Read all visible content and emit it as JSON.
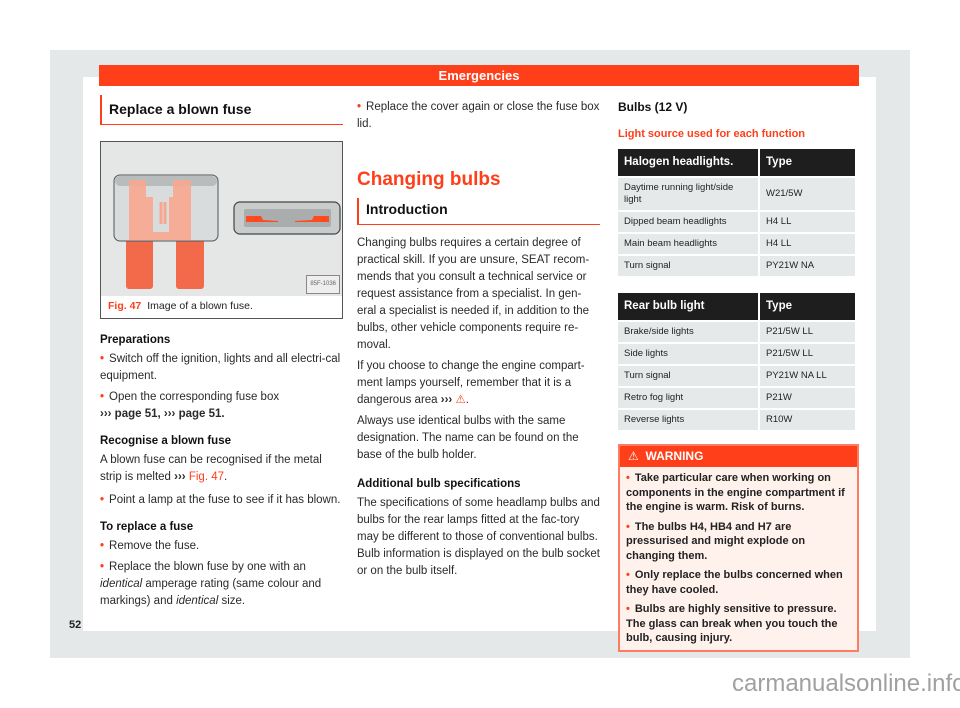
{
  "header": {
    "section": "Emergencies"
  },
  "left": {
    "title": "Replace a blown fuse",
    "figure": {
      "code": "85F-1036",
      "label": "Fig. 47",
      "caption": "Image of a blown fuse."
    },
    "preparations": {
      "heading": "Preparations",
      "bullets": [
        "Switch off the ignition, lights and all electri-cal equipment.",
        "Open the corresponding fuse box"
      ],
      "xref": "››› page 51, ››› page 51."
    },
    "recognise": {
      "heading": "Recognise a blown fuse",
      "text": "A blown fuse can be recognised if the metal strip is melted ",
      "xref_arrow": "›››",
      "xref_fig": "Fig. 47",
      "bullet": "Point a lamp at the fuse to see if it has blown."
    },
    "replace": {
      "heading": "To replace a fuse",
      "bullet1": "Remove the fuse.",
      "bullet2_pre": "Replace the blown fuse by one with an ",
      "bullet2_em1": "identical",
      "bullet2_mid": " amperage rating (same colour and markings) and ",
      "bullet2_em2": "identical",
      "bullet2_post": " size."
    }
  },
  "middle": {
    "bullet": "Replace the cover again or close the fuse box lid.",
    "title": "Changing bulbs",
    "subtitle": "Introduction",
    "p1": "Changing bulbs requires a certain degree of practical skill. If you are unsure, SEAT recom-mends that you consult a technical service or request assistance from a specialist. In gen-eral a specialist is needed if, in addition to the bulbs, other vehicle components require re-moval.",
    "p2": "If you choose to change the engine compart-ment lamps yourself, remember that it is a dangerous area ",
    "p2_arrow": "›››",
    "p3": "Always use identical bulbs with the same designation. The name can be found on the base of the bulb holder.",
    "additional_heading": "Additional bulb specifications",
    "p4": "The specifications of some headlamp bulbs and bulbs for the rear lamps fitted at the fac-tory may be different to those of conventional bulbs. Bulb information is displayed on the bulb socket or on the bulb itself."
  },
  "right": {
    "title": "Bulbs (12 V)",
    "table_title": "Light source used for each function",
    "table1": {
      "headers": [
        "Halogen headlights.",
        "Type"
      ],
      "rows": [
        [
          "Daytime running light/side light",
          "W21/5W"
        ],
        [
          "Dipped beam headlights",
          "H4 LL"
        ],
        [
          "Main beam headlights",
          "H4 LL"
        ],
        [
          "Turn signal",
          "PY21W NA"
        ]
      ]
    },
    "table2": {
      "headers": [
        "Rear bulb light",
        "Type"
      ],
      "rows": [
        [
          "Brake/side lights",
          "P21/5W LL"
        ],
        [
          "Side lights",
          "P21/5W LL"
        ],
        [
          "Turn signal",
          "PY21W NA LL"
        ],
        [
          "Retro fog light",
          "P21W"
        ],
        [
          "Reverse lights",
          "R10W"
        ]
      ]
    },
    "warning": {
      "label": "WARNING",
      "items": [
        "Take particular care when working on components in the engine compartment if the engine is warm. Risk of burns.",
        "The bulbs H4, HB4 and H7 are pressurised and might explode on changing them.",
        "Only replace the bulbs concerned when they have cooled.",
        "Bulbs are highly sensitive to pressure. The glass can break when you touch the bulb, causing injury."
      ]
    }
  },
  "footer": {
    "page_number": "52",
    "watermark": "carmanualsonline.info"
  },
  "colors": {
    "accent": "#ff3e1a",
    "frame": "#e4e8e9",
    "table_header": "#1e1e1e",
    "table_cell": "#e6e9ea",
    "warning_bg": "#fff1ec"
  }
}
